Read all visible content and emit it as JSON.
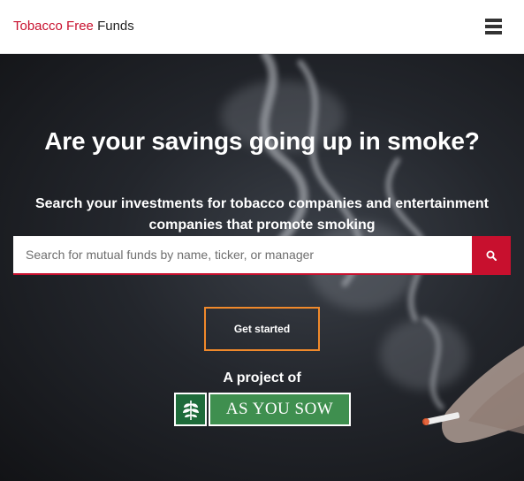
{
  "header": {
    "brand_part1": "Tobacco Free",
    "brand_part2": "Funds",
    "menu_icon": "hamburger-menu-icon"
  },
  "hero": {
    "headline": "Are your savings going up in smoke?",
    "subline": "Search your investments for tobacco companies and entertainment companies that promote smoking",
    "search": {
      "placeholder": "Search for mutual funds by name, ticker, or manager",
      "value": "",
      "button_icon": "search-icon"
    },
    "cta_label": "Get started",
    "project_label": "A project of",
    "partner_logo_text": "AS YOU SOW"
  },
  "colors": {
    "brand_red": "#c8102e",
    "cta_border": "#f0892b",
    "logo_green": "#3f8f4f"
  }
}
